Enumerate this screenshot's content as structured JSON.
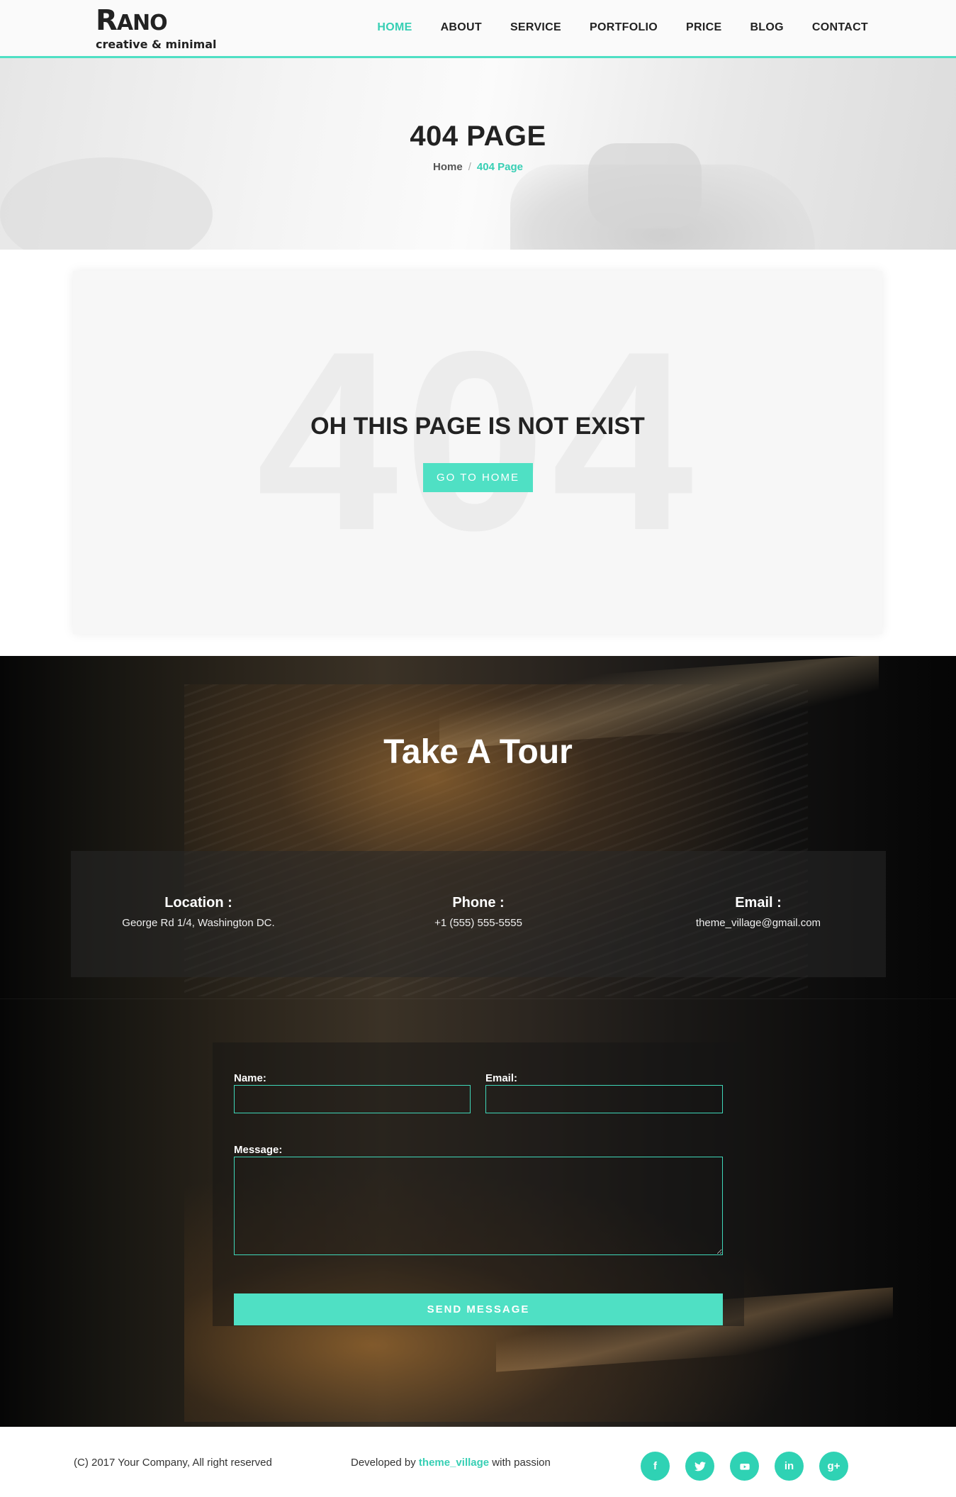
{
  "header": {
    "logo_title_big": "R",
    "logo_title_rest": "ANO",
    "logo_sub": "creative & minimal",
    "nav": [
      "HOME",
      "ABOUT",
      "SERVICE",
      "PORTFOLIO",
      "PRICE",
      "BLOG",
      "CONTACT"
    ],
    "active_nav": "HOME"
  },
  "hero": {
    "title": "404 PAGE",
    "breadcrumb_home": "Home",
    "breadcrumb_sep": "/",
    "breadcrumb_current": "404 Page"
  },
  "error": {
    "bg_text": "404",
    "heading": "OH THIS PAGE IS NOT EXIST",
    "button": "GO TO HOME"
  },
  "tour": {
    "title": "Take A Tour",
    "info": [
      {
        "label": "Location :",
        "value": "George Rd 1/4, Washington DC."
      },
      {
        "label": "Phone :",
        "value": "+1 (555) 555-5555"
      },
      {
        "label": "Email :",
        "value": "theme_village@gmail.com"
      }
    ]
  },
  "form": {
    "name_label": "Name:",
    "email_label": "Email:",
    "message_label": "Message:",
    "send_button": "SEND MESSAGE"
  },
  "footer": {
    "copyright": "(C) 2017 Your Company, All right reserved",
    "dev_prefix": "Developed by",
    "dev_brand": "theme_village",
    "dev_suffix": "with passion",
    "socials": [
      {
        "icon": "facebook-icon",
        "glyph": "f"
      },
      {
        "icon": "twitter-icon",
        "glyph": "🐦"
      },
      {
        "icon": "youtube-icon",
        "glyph": "▶"
      },
      {
        "icon": "linkedin-icon",
        "glyph": "in"
      },
      {
        "icon": "google-plus-icon",
        "glyph": "g+"
      }
    ]
  },
  "colors": {
    "accent": "#4fe0c4",
    "accent_text": "#37cfb4"
  }
}
